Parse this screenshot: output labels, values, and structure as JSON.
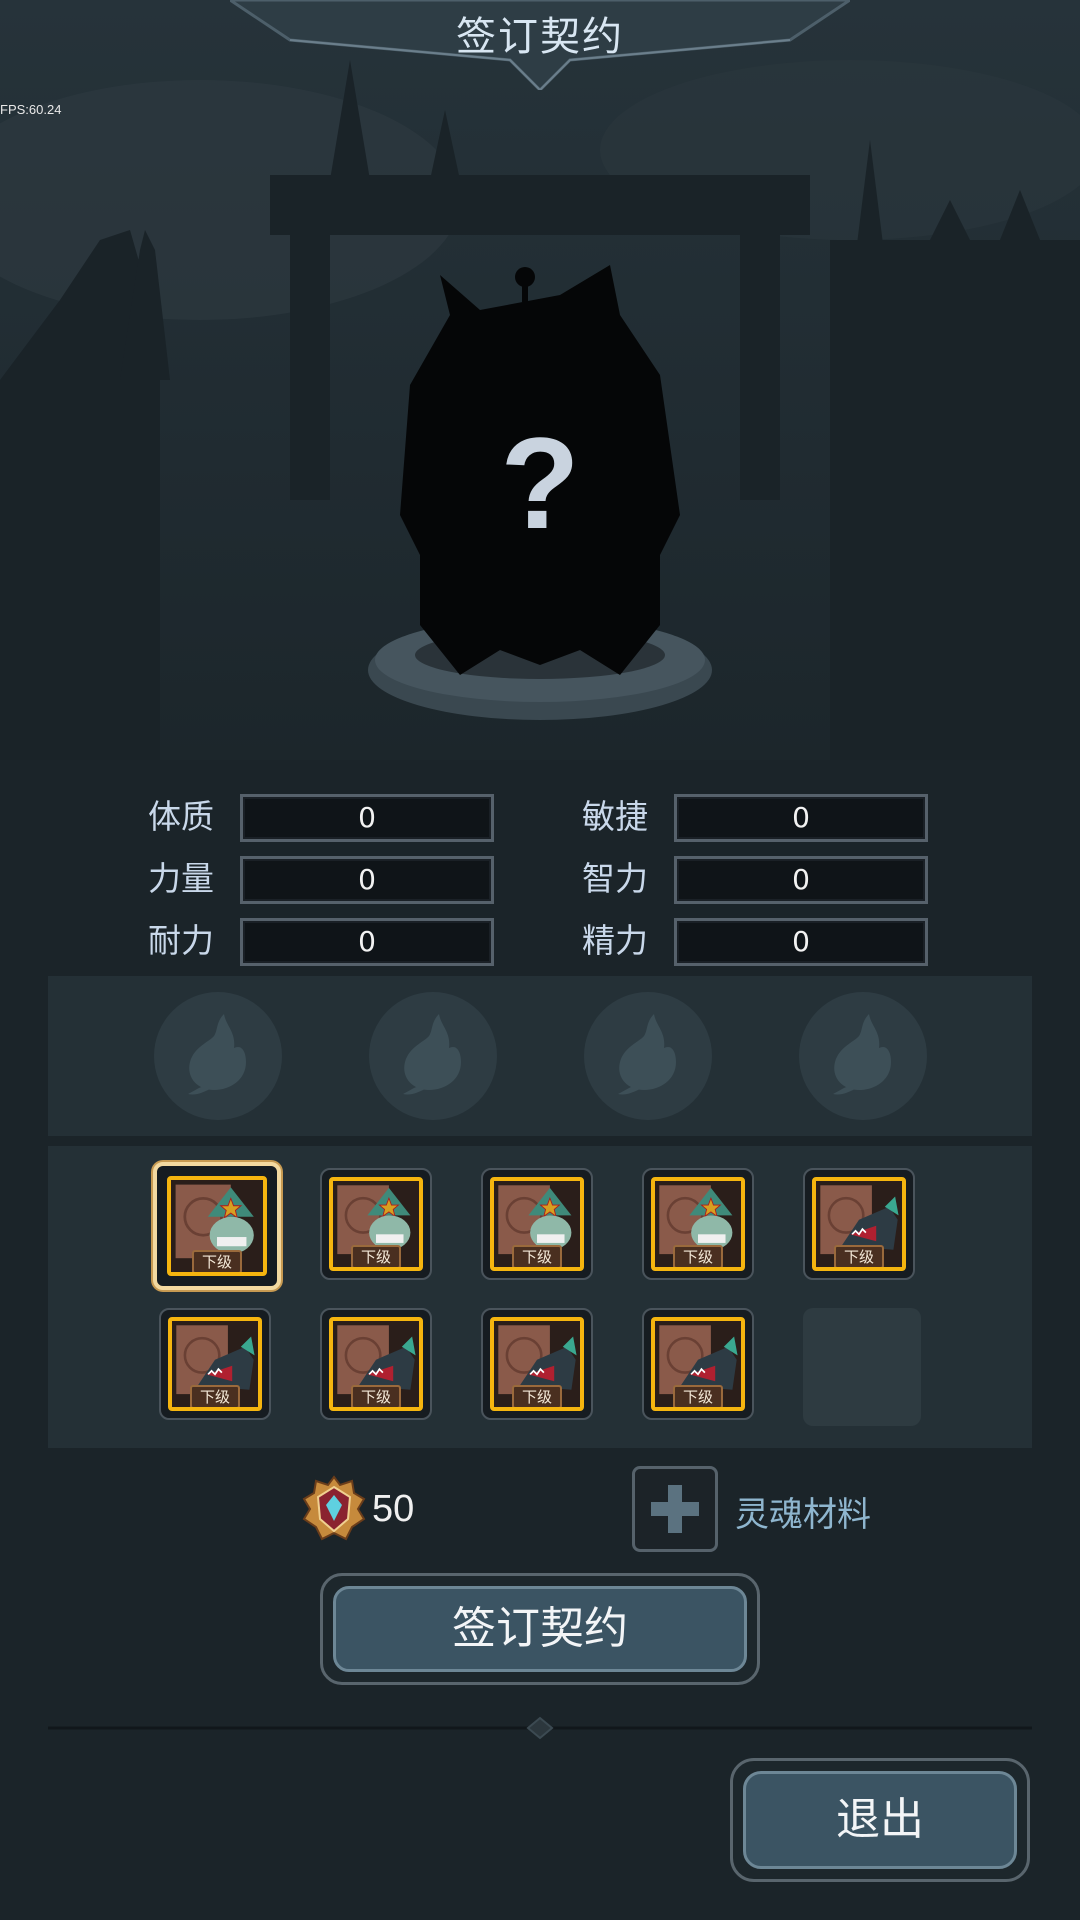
{
  "header": {
    "title": "签订契约"
  },
  "debug": {
    "fps": "FPS:60.24"
  },
  "preview": {
    "unknown_symbol": "?"
  },
  "stats": [
    {
      "label": "体质",
      "value": "0"
    },
    {
      "label": "敏捷",
      "value": "0"
    },
    {
      "label": "力量",
      "value": "0"
    },
    {
      "label": "智力",
      "value": "0"
    },
    {
      "label": "耐力",
      "value": "0"
    },
    {
      "label": "精力",
      "value": "0"
    }
  ],
  "skills": {
    "slot_count": 4,
    "slot_icon": "flame-icon"
  },
  "contracts": {
    "items": [
      {
        "tag": "下级",
        "creature": "goblin-shaman",
        "selected": true
      },
      {
        "tag": "下级",
        "creature": "goblin-shaman",
        "selected": false
      },
      {
        "tag": "下级",
        "creature": "goblin-shaman",
        "selected": false
      },
      {
        "tag": "下级",
        "creature": "goblin-shaman",
        "selected": false
      },
      {
        "tag": "下级",
        "creature": "raptor",
        "selected": false
      },
      {
        "tag": "下级",
        "creature": "raptor",
        "selected": false
      },
      {
        "tag": "下级",
        "creature": "raptor",
        "selected": false
      },
      {
        "tag": "下级",
        "creature": "raptor",
        "selected": false
      },
      {
        "tag": "下级",
        "creature": "raptor",
        "selected": false
      }
    ],
    "empty_slots": 1
  },
  "cost": {
    "icon": "crest-gem-icon",
    "value": "50"
  },
  "material": {
    "add_icon": "plus-icon",
    "label": "灵魂材料"
  },
  "actions": {
    "sign_label": "签订契约",
    "exit_label": "退出"
  },
  "colors": {
    "background": "#1b2429",
    "card_frame": "#f5b50f",
    "button_fill": "#3b5463",
    "material_text": "#8fb6cf"
  }
}
